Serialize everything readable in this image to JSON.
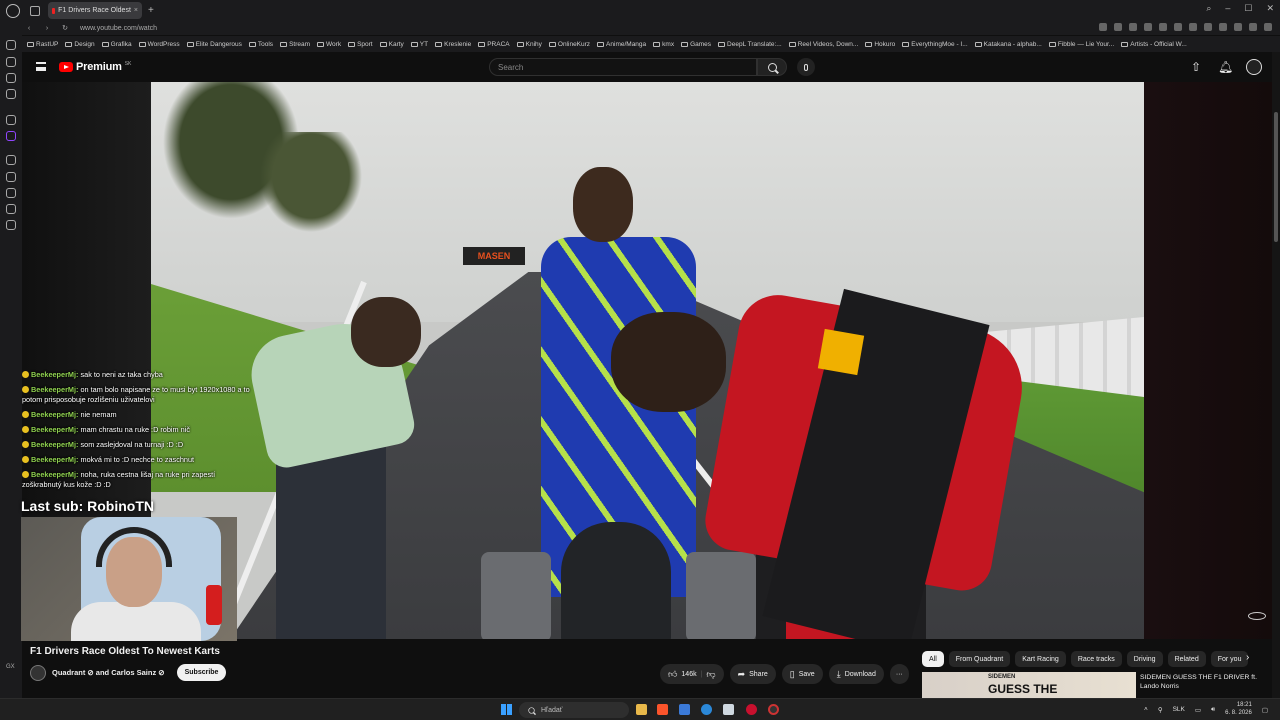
{
  "browser": {
    "tab_title": "F1 Drivers Race Oldest",
    "url": "www.youtube.com/watch",
    "bookmarks": [
      "RastUP",
      "Design",
      "Grafika",
      "WordPress",
      "Elite Dangerous",
      "Tools",
      "Stream",
      "Work",
      "Sport",
      "Karty",
      "YT",
      "Kreslenie",
      "PRACA",
      "Knihy",
      "OnlineKurz",
      "Anime/Manga",
      "kmx",
      "Games",
      "DeepL Translate:...",
      "Reel Videos, Down...",
      "Hokuro",
      "EverythingMoe - I...",
      "Katakana - alphab...",
      "Fibble — Lie Your...",
      "Artists - Official W..."
    ]
  },
  "youtube": {
    "logo_text": "Premium",
    "logo_country": "SK",
    "search_placeholder": "Search"
  },
  "stream_overlay": {
    "chat": [
      {
        "user": "BeekeeperMj:",
        "text": "sak to neni az taka chyba"
      },
      {
        "user": "BeekeeperMj:",
        "text": "on tam bolo napisane ze to musi byt 1920x1080 a to potom prisposobuje rozlišeniu uživatelovi"
      },
      {
        "user": "BeekeeperMj:",
        "text": "nie nemam"
      },
      {
        "user": "BeekeeperMj:",
        "text": "mam chrastu na ruke :D robim nič"
      },
      {
        "user": "BeekeeperMj:",
        "text": "som zaslejdoval na turnaji :D :D"
      },
      {
        "user": "BeekeeperMj:",
        "text": "mokvá mi to :D nechce to zaschnut"
      },
      {
        "user": "BeekeeperMj:",
        "text": "noha, ruka cestna lišaj na ruke pri zapestí zoškrabnutý kus kože :D :D"
      }
    ],
    "last_sub": "Last sub: RobinoTN"
  },
  "video": {
    "sign_text": "MASEN",
    "title": "F1 Drivers Race Oldest To Newest Karts",
    "channel": "Quadrant ⊘ and Carlos Sainz ⊘",
    "subscribe_label": "Subscribe",
    "likes": "146k",
    "share_label": "Share",
    "save_label": "Save",
    "download_label": "Download",
    "more_label": "···"
  },
  "chips": [
    "All",
    "From Quadrant",
    "Kart Racing",
    "Race tracks",
    "Driving",
    "Related",
    "For you"
  ],
  "recommendation": {
    "thumb_top": "SIDEMEN",
    "thumb_big": "GUESS THE",
    "title": "SIDEMEN GUESS THE F1 DRIVER ft. Lando Norris"
  },
  "taskbar": {
    "search_placeholder": "Hľadať",
    "lang": "SLK",
    "time": "18:21",
    "date": "6. 8. 2026"
  }
}
